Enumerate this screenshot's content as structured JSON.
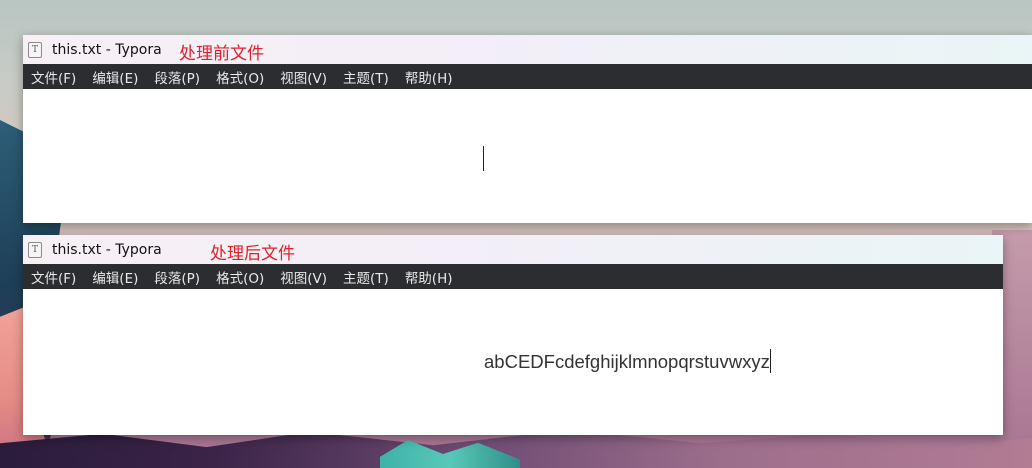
{
  "windows": [
    {
      "title": "this.txt - Typora",
      "annotation": "处理前文件",
      "menu": [
        "文件(F)",
        "编辑(E)",
        "段落(P)",
        "格式(O)",
        "视图(V)",
        "主题(T)",
        "帮助(H)"
      ],
      "content": ""
    },
    {
      "title": "this.txt - Typora",
      "annotation": "处理后文件",
      "menu": [
        "文件(F)",
        "编辑(E)",
        "段落(P)",
        "格式(O)",
        "视图(V)",
        "主题(T)",
        "帮助(H)"
      ],
      "content": "abCEDFcdefghijklmnopqrstuvwxyz"
    }
  ],
  "app_icon_glyph": "T",
  "colors": {
    "menubar_bg": "#2b2d30",
    "menubar_text": "#e8e8e8",
    "annotation": "#e0202a",
    "editor_bg": "#ffffff"
  }
}
